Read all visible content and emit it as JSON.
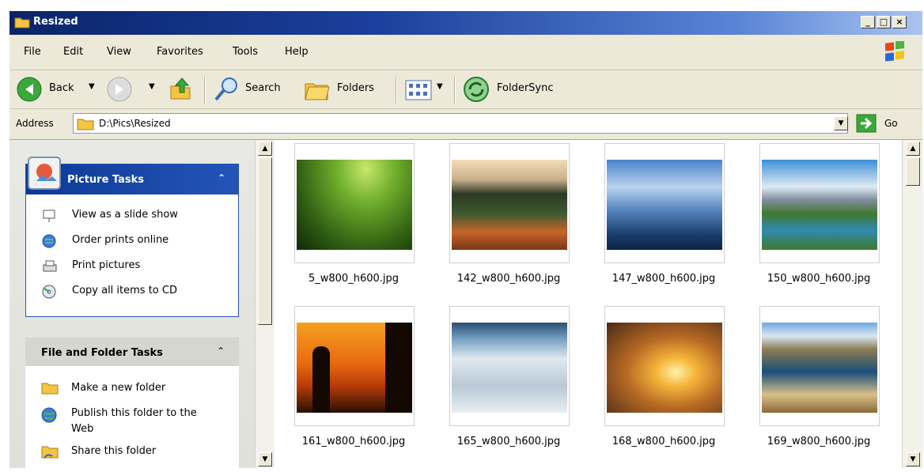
{
  "window": {
    "title": "Resized"
  },
  "menu": [
    "File",
    "Edit",
    "View",
    "Favorites",
    "Tools",
    "Help"
  ],
  "toolbar": {
    "back": "Back",
    "search": "Search",
    "folders": "Folders",
    "foldersync": "FolderSync"
  },
  "address": {
    "label": "Address",
    "value": "D:\\Pics\\Resized",
    "go": "Go"
  },
  "picture_tasks": {
    "title": "Picture Tasks",
    "items": [
      "View as a slide show",
      "Order prints online",
      "Print pictures",
      "Copy all items to CD"
    ]
  },
  "file_tasks": {
    "title": "File and Folder Tasks",
    "items": [
      "Make a new folder",
      "Publish this folder to the",
      "Web",
      "Share this folder"
    ]
  },
  "files": [
    {
      "name": "5_w800_h600.jpg",
      "scene": "grass"
    },
    {
      "name": "142_w800_h600.jpg",
      "scene": "canyon"
    },
    {
      "name": "147_w800_h600.jpg",
      "scene": "sky"
    },
    {
      "name": "150_w800_h600.jpg",
      "scene": "mountain-lake"
    },
    {
      "name": "161_w800_h600.jpg",
      "scene": "sunset-silhouette"
    },
    {
      "name": "165_w800_h600.jpg",
      "scene": "ice"
    },
    {
      "name": "168_w800_h600.jpg",
      "scene": "golden-sky"
    },
    {
      "name": "169_w800_h600.jpg",
      "scene": "river-canyon"
    }
  ]
}
